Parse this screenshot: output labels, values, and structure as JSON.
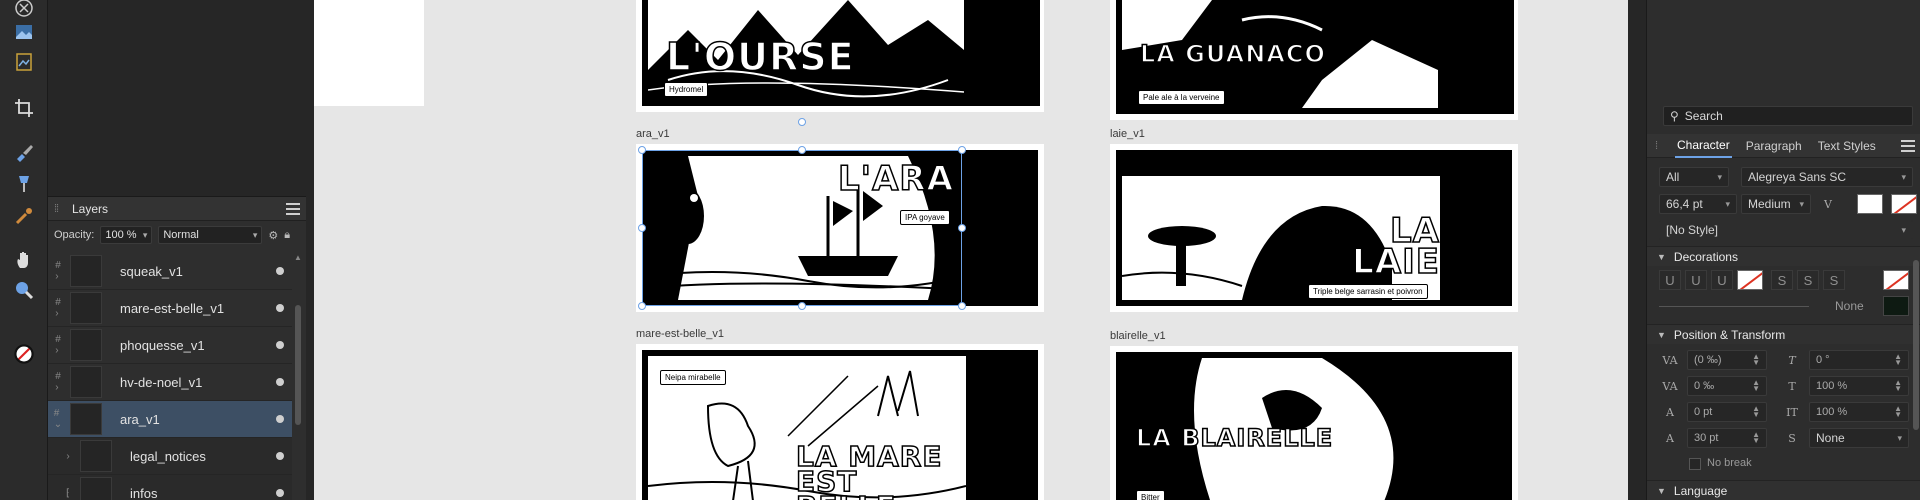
{
  "layers": {
    "panel_title": "Layers",
    "opacity_label": "Opacity:",
    "opacity_value": "100 %",
    "blend_mode": "Normal",
    "items": [
      {
        "name": "squeak_v1"
      },
      {
        "name": "mare-est-belle_v1"
      },
      {
        "name": "phoquesse_v1"
      },
      {
        "name": "hv-de-noel_v1"
      },
      {
        "name": "ara_v1",
        "selected": true
      },
      {
        "name": "legal_notices",
        "child": true
      },
      {
        "name": "infos",
        "child": true
      }
    ]
  },
  "canvas": {
    "artboards": [
      {
        "label": "ara_v1",
        "title": "L'ARA",
        "badge": "IPA goyave"
      },
      {
        "label": "laie_v1",
        "title": "LA LAIE",
        "badge": "Triple belge sarrasin et poivron"
      },
      {
        "label": "mare-est-belle_v1",
        "title": "LA MARE EST BELLE",
        "badge": "Neipa mirabelle"
      },
      {
        "label": "blairelle_v1",
        "title": "LA BLAIRELLE",
        "badge": "Bitter"
      },
      {
        "label": "",
        "title": "L'OURSE",
        "badge": "Hydromel"
      },
      {
        "label": "",
        "title": "LA GUANACO",
        "badge": "Pale ale à la verveine"
      }
    ]
  },
  "character_panel": {
    "search_placeholder": "Search",
    "tabs": [
      "Character",
      "Paragraph",
      "Text Styles"
    ],
    "active_tab": "Character",
    "scope": "All",
    "font_family": "Alegreya Sans SC",
    "font_size": "66,4 pt",
    "font_weight": "Medium",
    "style": "[No Style]",
    "decorations_title": "Decorations",
    "decoration_line": "None",
    "position_title": "Position & Transform",
    "tracking": "(0 ‰)",
    "shear": "0 °",
    "kerning": "0 ‰",
    "scale_h": "100 %",
    "baseline": "0 pt",
    "scale_v": "100 %",
    "leading": "30 pt",
    "typography": "None",
    "no_break": "No break",
    "language_title": "Language"
  },
  "colors": {
    "accent": "#6da2e6",
    "selected_row": "#3d4f64"
  }
}
